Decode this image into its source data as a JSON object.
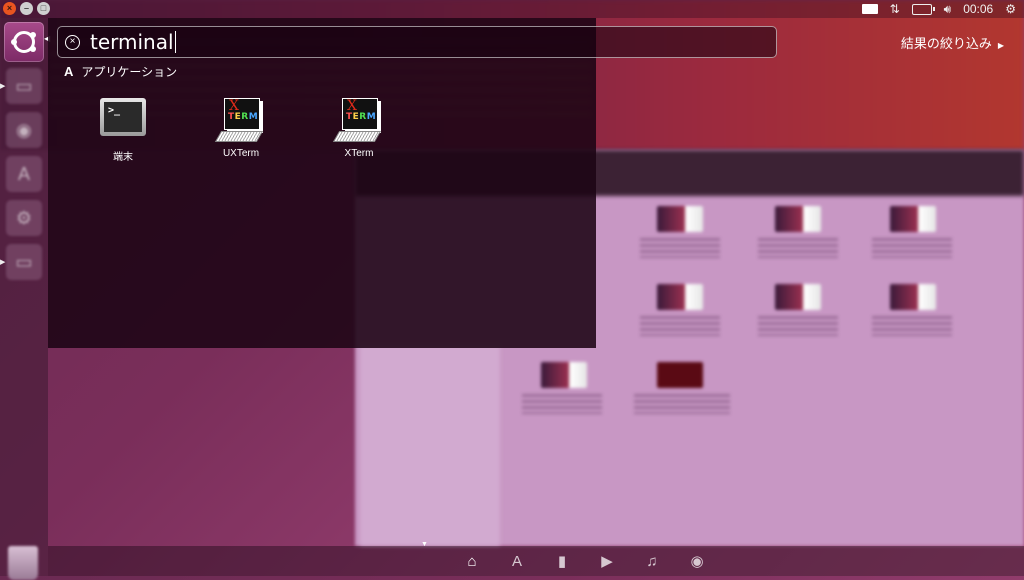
{
  "window_controls": [
    "×",
    "–",
    "□"
  ],
  "panel": {
    "clock": "00:06"
  },
  "search": {
    "query": "terminal"
  },
  "filter_results_label": "結果の絞り込み",
  "category": {
    "title": "アプリケーション"
  },
  "apps": [
    {
      "name": "端末",
      "icon": "terminal-icon"
    },
    {
      "name": "UXTerm",
      "icon": "xterm-icon"
    },
    {
      "name": "XTerm",
      "icon": "xterm-icon"
    }
  ],
  "xterm_icon_text": {
    "x": "X",
    "letters": [
      "T",
      "E",
      "R",
      "M"
    ]
  },
  "terminal_prompt": ">_",
  "lenses": [
    {
      "name": "home-lens",
      "glyph": "⌂",
      "active": true
    },
    {
      "name": "applications-lens",
      "glyph": "A",
      "active": false
    },
    {
      "name": "files-lens",
      "glyph": "▮",
      "active": false
    },
    {
      "name": "video-lens",
      "glyph": "▶",
      "active": false
    },
    {
      "name": "music-lens",
      "glyph": "♫",
      "active": false
    },
    {
      "name": "photo-lens",
      "glyph": "◉",
      "active": false
    }
  ],
  "colors": {
    "accent": "#e95420",
    "dash_background": "#1c0414",
    "desktop": "#8e3a6a"
  }
}
